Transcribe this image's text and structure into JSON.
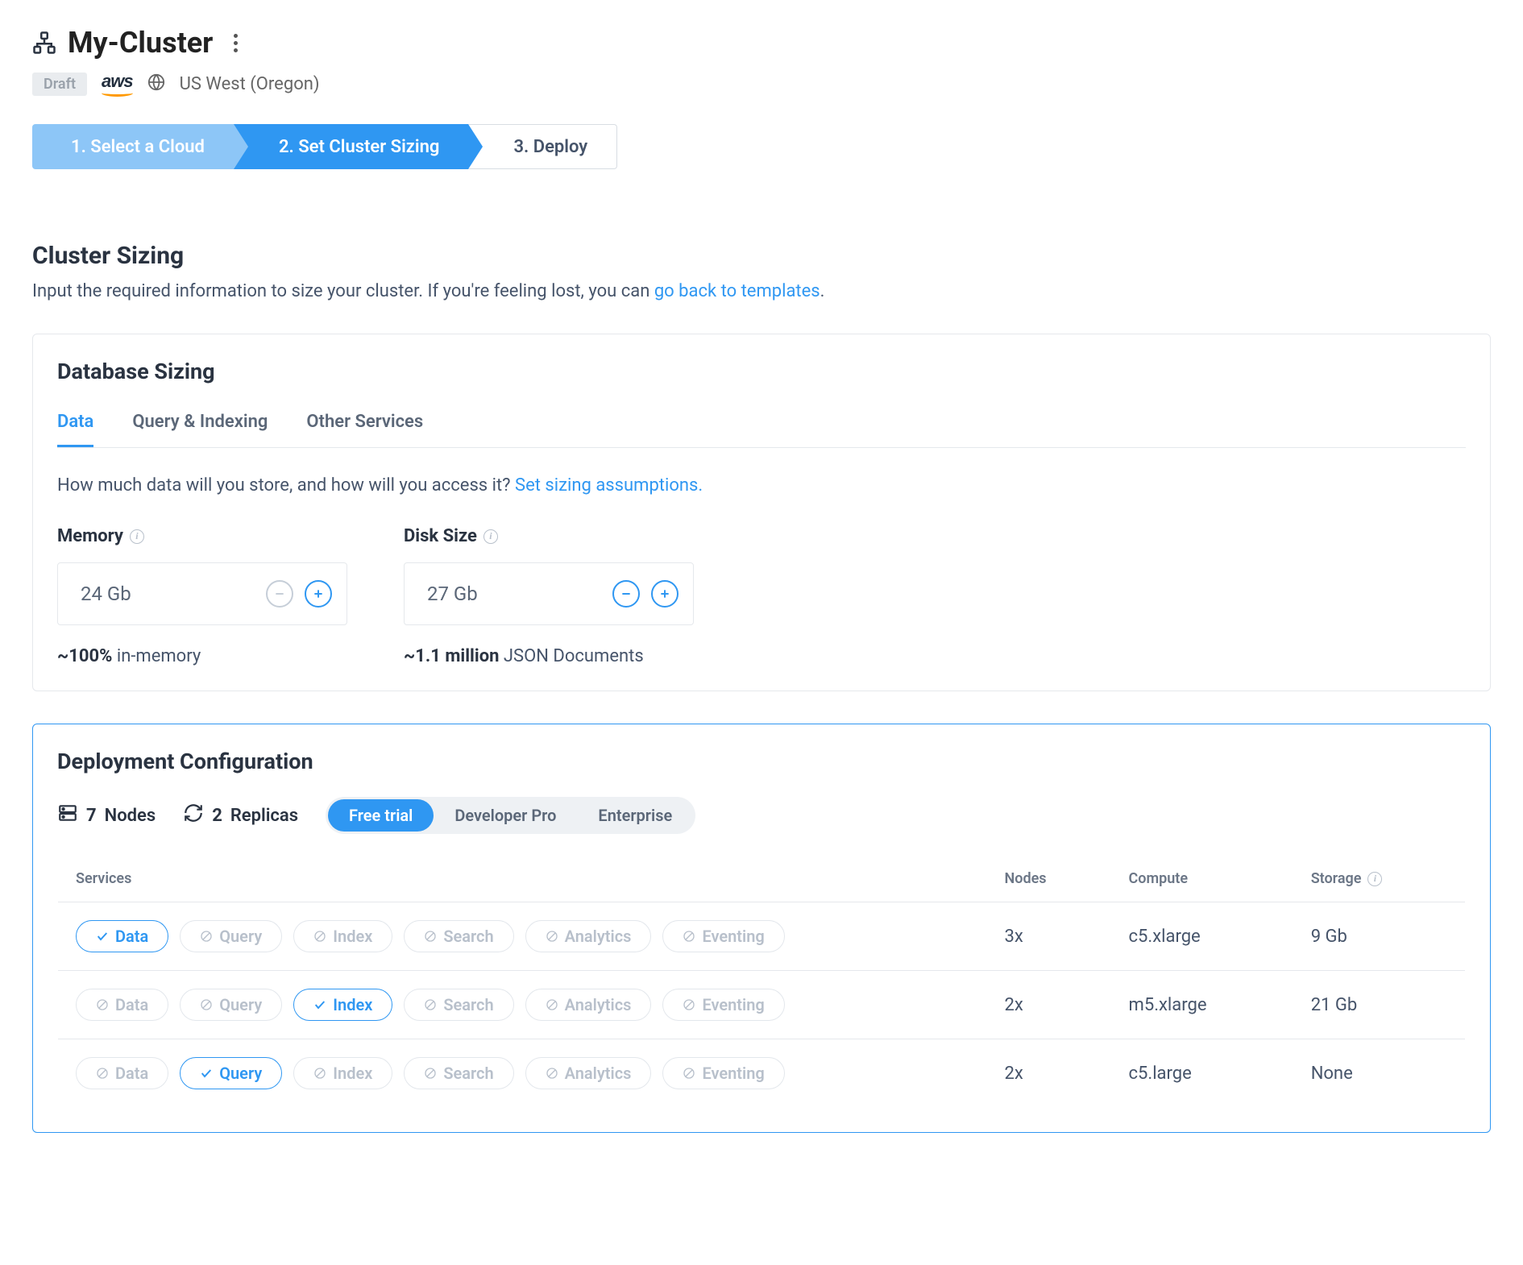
{
  "header": {
    "title": "My-Cluster",
    "status_badge": "Draft",
    "provider": "aws",
    "region": "US West (Oregon)"
  },
  "steps": {
    "s1": "1. Select a Cloud",
    "s2": "2. Set Cluster Sizing",
    "s3": "3. Deploy"
  },
  "sizing_section": {
    "title": "Cluster Sizing",
    "desc_pre": "Input the required information to size your cluster. If you're feeling lost, you can ",
    "desc_link": "go back to templates",
    "desc_post": "."
  },
  "db_card": {
    "title": "Database Sizing",
    "tabs": {
      "data": "Data",
      "query": "Query & Indexing",
      "other": "Other Services"
    },
    "body_pre": "How much data will you store, and how will you access it? ",
    "body_link": "Set sizing assumptions.",
    "memory": {
      "label": "Memory",
      "value": "24 Gb",
      "sub_bold": "~100%",
      "sub_rest": " in-memory"
    },
    "disk": {
      "label": "Disk Size",
      "value": "27 Gb",
      "sub_bold": "~1.1 million",
      "sub_rest": " JSON Documents"
    }
  },
  "dep_card": {
    "title": "Deployment Configuration",
    "nodes_count": "7",
    "nodes_label": "Nodes",
    "replicas_count": "2",
    "replicas_label": "Replicas",
    "seg": {
      "free": "Free trial",
      "dev": "Developer Pro",
      "ent": "Enterprise"
    },
    "th": {
      "services": "Services",
      "nodes": "Nodes",
      "compute": "Compute",
      "storage": "Storage"
    },
    "services": {
      "data": "Data",
      "query": "Query",
      "index": "Index",
      "search": "Search",
      "analytics": "Analytics",
      "eventing": "Eventing"
    },
    "rows": [
      {
        "selected": "data",
        "nodes": "3x",
        "compute": "c5.xlarge",
        "storage": "9 Gb"
      },
      {
        "selected": "index",
        "nodes": "2x",
        "compute": "m5.xlarge",
        "storage": "21 Gb"
      },
      {
        "selected": "query",
        "nodes": "2x",
        "compute": "c5.large",
        "storage": "None"
      }
    ]
  }
}
